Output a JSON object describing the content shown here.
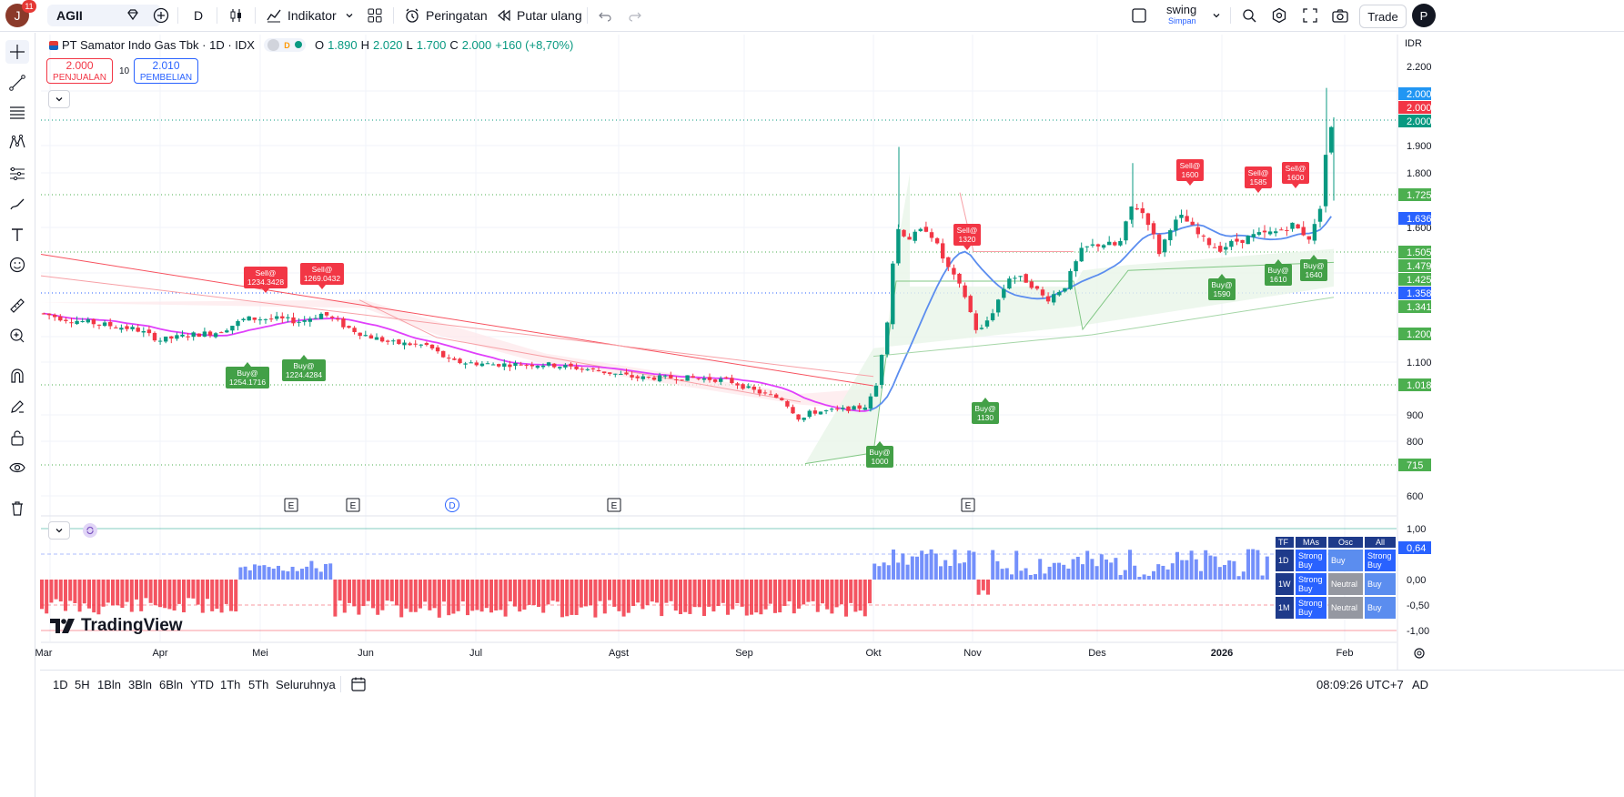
{
  "toolbar": {
    "avatar_letter": "J",
    "notification_count": "11",
    "symbol": "AGII",
    "interval": "D",
    "indicators_label": "Indikator",
    "alerts_label": "Peringatan",
    "replay_label": "Putar ulang",
    "layout_name": "swing",
    "layout_status": "Simpan",
    "trade_label": "Trade",
    "extra_letter": "P"
  },
  "legend": {
    "title": "PT Samator Indo Gas Tbk · 1D · IDX",
    "o_label": "O",
    "o": "1.890",
    "h_label": "H",
    "h": "2.020",
    "l_label": "L",
    "l": "1.700",
    "c_label": "C",
    "c": "2.000",
    "change": "+160 (+8,70%)"
  },
  "order": {
    "sell_price": "2.000",
    "sell_label": "PENJUALAN",
    "spread": "10",
    "buy_price": "2.010",
    "buy_label": "PEMBELIAN"
  },
  "currency": "IDR",
  "price_axis": [
    "2.200",
    "1.900",
    "1.800",
    "1.600",
    "1.100",
    "900",
    "800",
    "600"
  ],
  "price_tags": [
    {
      "text": "2.000",
      "color": "#2196f3"
    },
    {
      "text": "2.000",
      "color": "#f23645"
    },
    {
      "text": "2.000",
      "color": "#089981"
    },
    {
      "text": "1.725",
      "color": "#4caf50"
    },
    {
      "text": "1.636",
      "color": "#2962ff"
    },
    {
      "text": "1.505",
      "color": "#4caf50"
    },
    {
      "text": "1.479",
      "color": "#4caf50"
    },
    {
      "text": "1.425",
      "color": "#4caf50"
    },
    {
      "text": "1.358",
      "color": "#2962ff"
    },
    {
      "text": "1.341",
      "color": "#4caf50"
    },
    {
      "text": "1.200",
      "color": "#4caf50"
    },
    {
      "text": "1.018",
      "color": "#4caf50"
    },
    {
      "text": "715",
      "color": "#4caf50"
    }
  ],
  "osc_axis": [
    "1,00",
    "0,00",
    "-0,50",
    "-1,00"
  ],
  "osc_tag": "0,64",
  "time_axis": [
    "Mar",
    "Apr",
    "Mei",
    "Jun",
    "Jul",
    "Agst",
    "Sep",
    "Okt",
    "Nov",
    "Des",
    "2026",
    "Feb"
  ],
  "event_markers": [
    "E",
    "E",
    "D",
    "E",
    "E"
  ],
  "signals": [
    {
      "kind": "sell",
      "line1": "Sell@",
      "line2": "1234.3428"
    },
    {
      "kind": "sell",
      "line1": "Sell@",
      "line2": "1269.0432"
    },
    {
      "kind": "buy",
      "line1": "Buy@",
      "line2": "1254.1716"
    },
    {
      "kind": "buy",
      "line1": "Buy@",
      "line2": "1224.4284"
    },
    {
      "kind": "sell",
      "line1": "Sell@",
      "line2": "1320"
    },
    {
      "kind": "buy",
      "line1": "Buy@",
      "line2": "1130"
    },
    {
      "kind": "buy",
      "line1": "Buy@",
      "line2": "1000"
    },
    {
      "kind": "sell",
      "line1": "Sell@",
      "line2": "1600"
    },
    {
      "kind": "sell",
      "line1": "Sell@",
      "line2": "1585"
    },
    {
      "kind": "sell",
      "line1": "Sell@",
      "line2": "1600"
    },
    {
      "kind": "buy",
      "line1": "Buy@",
      "line2": "1590"
    },
    {
      "kind": "buy",
      "line1": "Buy@",
      "line2": "1610"
    },
    {
      "kind": "buy",
      "line1": "Buy@",
      "line2": "1640"
    }
  ],
  "ratings": {
    "headers": [
      "TF",
      "MAs",
      "Osc",
      "All"
    ],
    "rows": [
      [
        "1D",
        "Strong Buy",
        "Buy",
        "Strong Buy"
      ],
      [
        "1W",
        "Strong Buy",
        "Neutral",
        "Buy"
      ],
      [
        "1M",
        "Strong Buy",
        "Neutral",
        "Buy"
      ]
    ]
  },
  "watermark": "TradingView",
  "bottom": {
    "ranges": [
      "1D",
      "5H",
      "1Bln",
      "3Bln",
      "6Bln",
      "YTD",
      "1Th",
      "5Th",
      "Seluruhnya"
    ],
    "clock": "08:09:26 UTC+7",
    "adj": "AD"
  },
  "colors": {
    "up": "#089981",
    "down": "#f23645",
    "ma_blue": "#5b8def",
    "ma_pink": "#e040fb",
    "osc_blue": "#5c7cfa",
    "osc_red": "#f23645"
  }
}
